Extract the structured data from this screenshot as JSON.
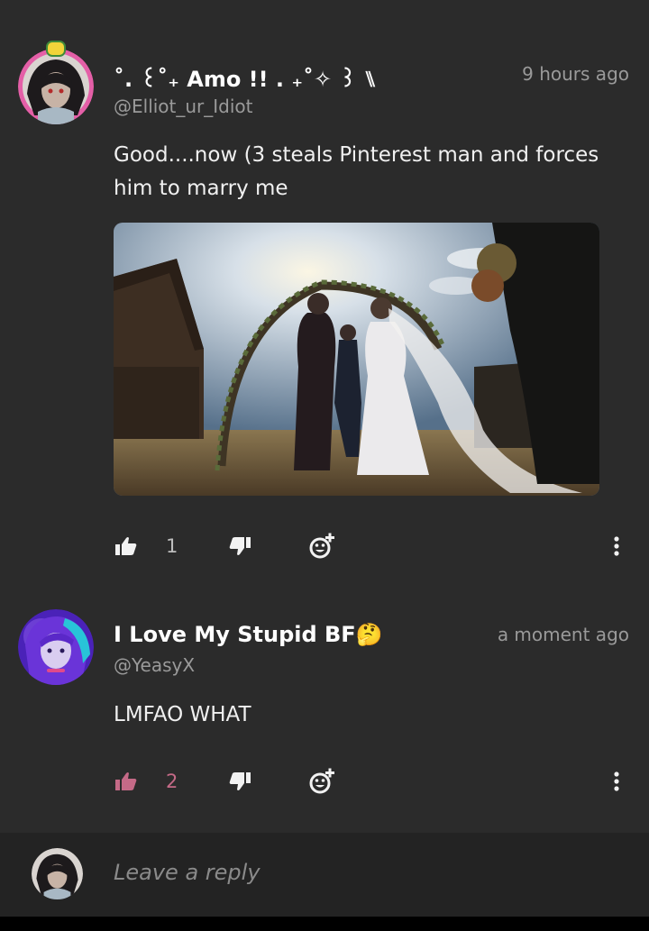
{
  "comments": [
    {
      "name": "˚. ꒰˚₊ Amo !! . ₊˚✧ ꒱ ⑊",
      "handle": "@Elliot_ur_Idiot",
      "time": "9 hours ago",
      "text": "Good....now (3 steals Pinterest man and forces him to marry me",
      "has_image": true,
      "likes": "1",
      "liked": false,
      "avatar_ring": "#e45fa7"
    },
    {
      "name": "I Love My Stupid BF🤔",
      "handle": "@YeasyX",
      "time": "a moment ago",
      "text": "LMFAO WHAT",
      "has_image": false,
      "likes": "2",
      "liked": true,
      "avatar_ring": "#6a34d8"
    }
  ],
  "reply": {
    "placeholder": "Leave a reply"
  },
  "icons": {
    "like": "thumbs-up-icon",
    "dislike": "thumbs-down-icon",
    "react": "add-reaction-icon",
    "more": "more-vertical-icon"
  },
  "colors": {
    "background": "#2b2b2b",
    "liked_accent": "#c56a87",
    "muted": "#9a9a9a"
  }
}
